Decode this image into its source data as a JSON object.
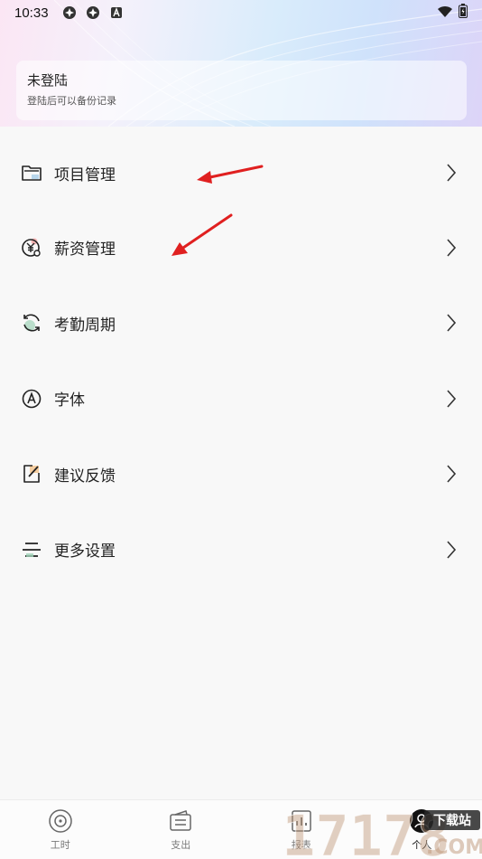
{
  "status_bar": {
    "time": "10:33"
  },
  "login_card": {
    "title": "未登陆",
    "subtitle": "登陆后可以备份记录"
  },
  "menu": {
    "items": [
      {
        "label": "项目管理",
        "icon": "folder-icon"
      },
      {
        "label": "薪资管理",
        "icon": "salary-icon"
      },
      {
        "label": "考勤周期",
        "icon": "cycle-icon"
      },
      {
        "label": "字体",
        "icon": "font-icon"
      },
      {
        "label": "建议反馈",
        "icon": "feedback-icon"
      },
      {
        "label": "更多设置",
        "icon": "settings-icon"
      }
    ]
  },
  "tabbar": {
    "tabs": [
      {
        "label": "工时",
        "icon": "clock-icon"
      },
      {
        "label": "支出",
        "icon": "wallet-icon"
      },
      {
        "label": "报表",
        "icon": "report-icon"
      },
      {
        "label": "个人",
        "icon": "person-icon",
        "active": true
      }
    ]
  },
  "watermark": {
    "text": "17178",
    "tag": "下载站",
    "suffix": ".COM"
  },
  "colors": {
    "accent_red": "#e02020",
    "text": "#222222",
    "muted": "#7a7a7a"
  }
}
